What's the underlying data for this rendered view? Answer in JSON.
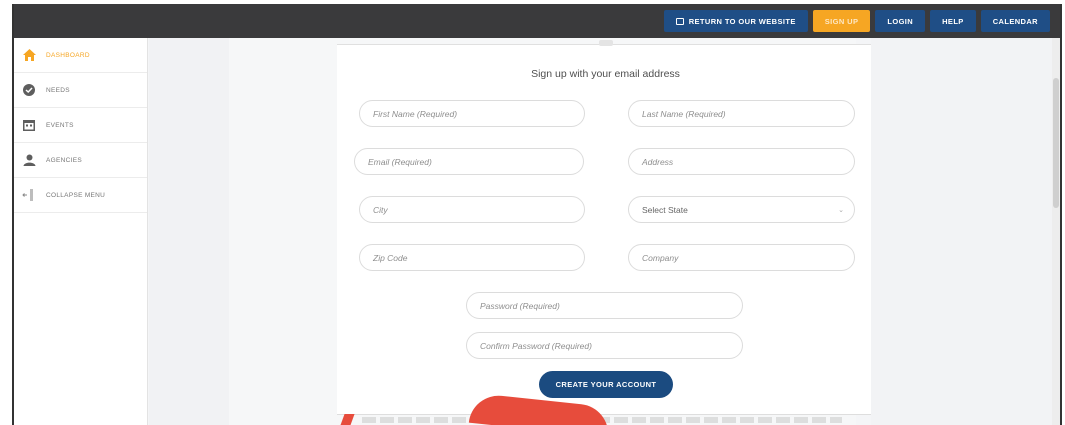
{
  "topnav": {
    "return_label": "RETURN TO OUR WEBSITE",
    "signup_label": "SIGN UP",
    "login_label": "LOGIN",
    "help_label": "HELP",
    "calendar_label": "CALENDAR"
  },
  "sidebar": {
    "items": [
      {
        "label": "DASHBOARD",
        "icon": "home-icon"
      },
      {
        "label": "NEEDS",
        "icon": "check-circle-icon"
      },
      {
        "label": "EVENTS",
        "icon": "calendar-icon"
      },
      {
        "label": "AGENCIES",
        "icon": "people-icon"
      },
      {
        "label": "COLLAPSE MENU",
        "icon": "collapse-icon"
      }
    ]
  },
  "form": {
    "title": "Sign up with your email address",
    "first_name": "First Name (Required)",
    "last_name": "Last Name (Required)",
    "email": "Email (Required)",
    "address": "Address",
    "city": "City",
    "state": "Select State",
    "zip": "Zip Code",
    "company": "Company",
    "password": "Password (Required)",
    "confirm_password": "Confirm Password (Required)",
    "submit_label": "CREATE YOUR ACCOUNT"
  },
  "colors": {
    "topbar": "#3a3a3c",
    "nav_button": "#1f4e86",
    "signup_button": "#f6a623",
    "primary_button": "#1b4b80",
    "accent_active": "#f6a623"
  }
}
